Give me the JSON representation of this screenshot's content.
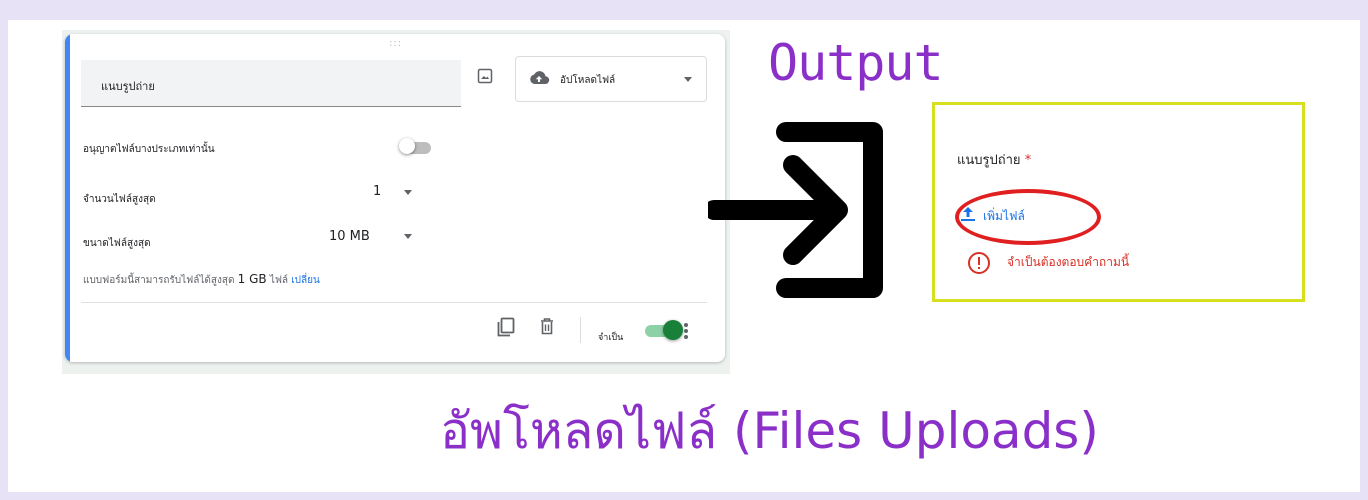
{
  "editor": {
    "question_title": "แนบรูปถ่าย",
    "question_type": "อัปโหลดไฟล์",
    "allow_specific_types_label": "อนุญาตไฟล์บางประเภทเท่านั้น",
    "max_files_label": "จำนวนไฟล์สูงสุด",
    "max_files_value": "1",
    "max_size_label": "ขนาดไฟล์สูงสุด",
    "max_size_value": "10 MB",
    "footnote_prefix": "แบบฟอร์มนี้สามารถรับไฟล์ได้สูงสุด",
    "footnote_size": "1 GB",
    "footnote_suffix": "ไฟล์",
    "footnote_link": "เปลี่ยน",
    "drag_handle": ":::",
    "required_label": "จำเป็น"
  },
  "annotation": {
    "output_title": "Output",
    "bottom_title": "อัพโหลดไฟล์ (Files Uploads)"
  },
  "preview": {
    "question_label": "แนบรูปถ่าย",
    "required_mark": "*",
    "add_file_label": "เพิ่มไฟล์",
    "error_text": "จำเป็นต้องตอบคำถามนี้"
  },
  "colors": {
    "accent": "#4285f4",
    "toggle_on": "#188038",
    "annotation_purple": "#8b2fc9",
    "output_border": "#d7e01f",
    "error_red": "#d93025",
    "link_blue": "#1a73e8"
  },
  "icons": [
    "image-icon",
    "cloud-upload-icon",
    "copy-icon",
    "trash-icon",
    "more-vert-icon",
    "upload-icon",
    "error-icon",
    "arrow-into-icon"
  ]
}
